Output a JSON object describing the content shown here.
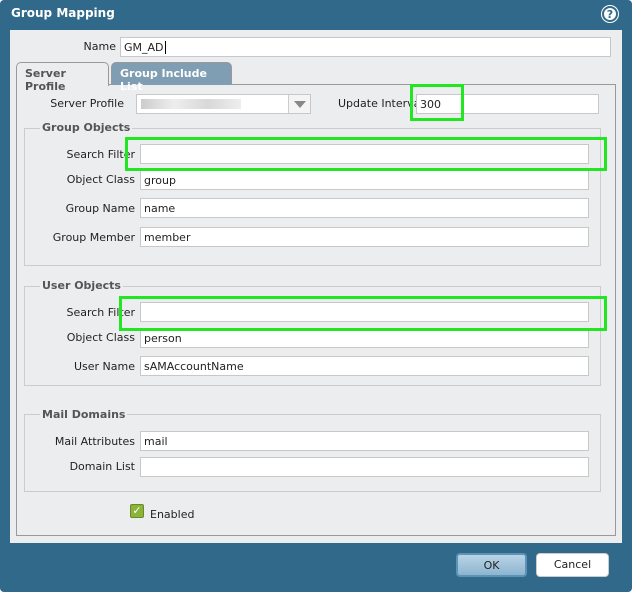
{
  "dialog": {
    "title": "Group Mapping",
    "help_icon": "question-circle-icon"
  },
  "name": {
    "label": "Name",
    "value": "GM_AD"
  },
  "tabs": [
    {
      "label": "Server Profile",
      "active": true
    },
    {
      "label": "Group Include List",
      "active": false
    }
  ],
  "server_profile": {
    "label": "Server Profile",
    "value": ""
  },
  "update_interval": {
    "label": "Update Interval",
    "value": "300"
  },
  "group_objects": {
    "legend": "Group Objects",
    "search_filter": {
      "label": "Search Filter",
      "value": ""
    },
    "object_class": {
      "label": "Object Class",
      "value": "group"
    },
    "group_name": {
      "label": "Group Name",
      "value": "name"
    },
    "group_member": {
      "label": "Group Member",
      "value": "member"
    }
  },
  "user_objects": {
    "legend": "User Objects",
    "search_filter": {
      "label": "Search Filter",
      "value": ""
    },
    "object_class": {
      "label": "Object Class",
      "value": "person"
    },
    "user_name": {
      "label": "User Name",
      "value": "sAMAccountName"
    }
  },
  "mail_domains": {
    "legend": "Mail Domains",
    "mail_attributes": {
      "label": "Mail Attributes",
      "value": "mail"
    },
    "domain_list": {
      "label": "Domain List",
      "value": ""
    }
  },
  "enabled": {
    "label": "Enabled",
    "checked": true
  },
  "buttons": {
    "ok": "OK",
    "cancel": "Cancel"
  },
  "colors": {
    "frame": "#31698a",
    "highlight": "#22e622",
    "checkbox": "#8ab43a"
  }
}
